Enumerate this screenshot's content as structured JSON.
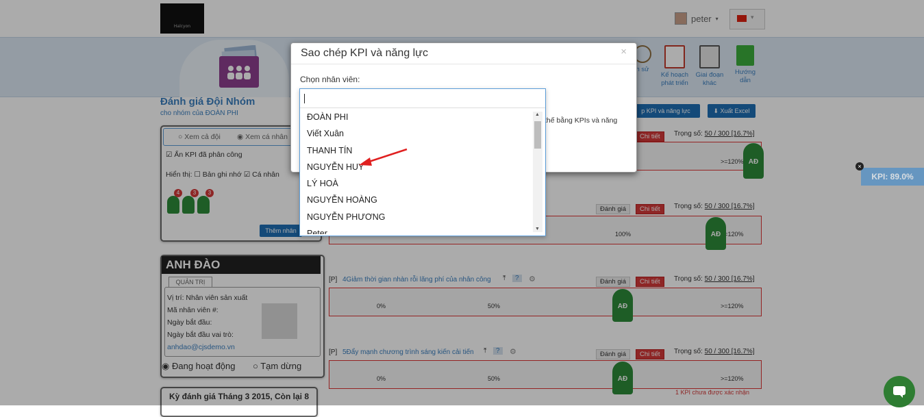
{
  "header": {
    "logo_text": "Halcyon",
    "user_name": "peter",
    "user_caret": "▾",
    "lang_caret": "▾"
  },
  "nav": {
    "items": [
      {
        "label": "h sử",
        "color": "#8c6d3f"
      },
      {
        "label": "Kế hoạch phát triển",
        "color": "#c0392b"
      },
      {
        "label": "Giai đoạn khác",
        "color": "#555555"
      },
      {
        "label": "Hướng dẫn",
        "color": "#3cae3c"
      }
    ]
  },
  "page": {
    "title": "Đánh giá Đội Nhóm",
    "subtitle": "cho nhóm của ĐOÀN PHI",
    "copy_button": "p KPI và năng lực",
    "excel_button": "Xuất Excel"
  },
  "filters": {
    "view_all": "Xem cả đội",
    "view_personal": "Xem cá nhân",
    "hide_assigned": "Ẩn KPI đã phân công",
    "show_label": "Hiển thị:",
    "notes_label": "Bản ghi nhớ",
    "personal_label": "Cá nhân",
    "add_member": "Thêm nhân",
    "badges": [
      "4",
      "3",
      "3"
    ]
  },
  "profile": {
    "name": "ANH ĐÀO",
    "tab": "QUẢN TRỊ",
    "position": "Vị trí: Nhân viên sản xuất",
    "employee_id": "Mã nhân viên #:",
    "start_date": "Ngày bắt đầu:",
    "role_start": "Ngày bắt đầu vai trò:",
    "email": "anhdao@cjsdemo.vn",
    "status_active": "Đang hoạt động",
    "status_paused": "Tạm dừng",
    "period": "Kỳ đánh giá Tháng 3 2015, Còn lại 8"
  },
  "kpis": [
    {
      "prefix": "",
      "title": "",
      "evaluate": "",
      "detail": "Chi tiết",
      "weight_label": "Trọng số:",
      "weight": "50 / 300 [16.7%]",
      "p0": "",
      "p50": "",
      "p100": "",
      "pmax": ">=120%"
    },
    {
      "prefix": "",
      "title": "",
      "evaluate": "Đánh giá",
      "detail": "Chi tiết",
      "weight_label": "Trọng số:",
      "weight": "50 / 300 [16.7%]",
      "p0": "0%",
      "p50": "50%",
      "p100": "100%",
      "pmax": ">=120%"
    },
    {
      "prefix": "[P]",
      "title": "4Giảm thời gian nhàn rỗi lãng phí của nhân công",
      "evaluate": "Đánh giá",
      "detail": "Chi tiết",
      "weight_label": "Trọng số:",
      "weight": "50 / 300 [16.7%]",
      "p0": "0%",
      "p50": "50%",
      "p100": "",
      "pmax": ">=120%"
    },
    {
      "prefix": "[P]",
      "title": "5Đẩy mạnh chương trình sáng kiến cải tiến",
      "evaluate": "Đánh giá",
      "detail": "Chi tiết",
      "weight_label": "Trọng số:",
      "weight": "50 / 300 [16.7%]",
      "p0": "0%",
      "p50": "50%",
      "p100": "",
      "pmax": ">=120%"
    }
  ],
  "unconfirmed_note": "1 KPI chưa được xác nhận",
  "kpi_badge": "KPI: 89.0%",
  "kpi_badge_close": "×",
  "modal": {
    "title": "Sao chép KPI và năng lực",
    "close": "×",
    "label": "Chọn nhân viên:",
    "partial_text": "thế bằng KPIs và năng",
    "input_value": "",
    "options": [
      "ĐOÀN PHI",
      "Viết Xuân",
      "THANH TÍN",
      "NGUYỄN HUY",
      "LÝ HOÀ",
      "NGUYỄN HOÀNG",
      "NGUYỄN PHƯƠNG",
      "Peter"
    ]
  },
  "avatar_letters": "AĐ",
  "colors": {
    "accent": "#3b7fbf",
    "danger": "#d43a3a",
    "person": "#2e8b3a",
    "arrow": "#e02020"
  }
}
